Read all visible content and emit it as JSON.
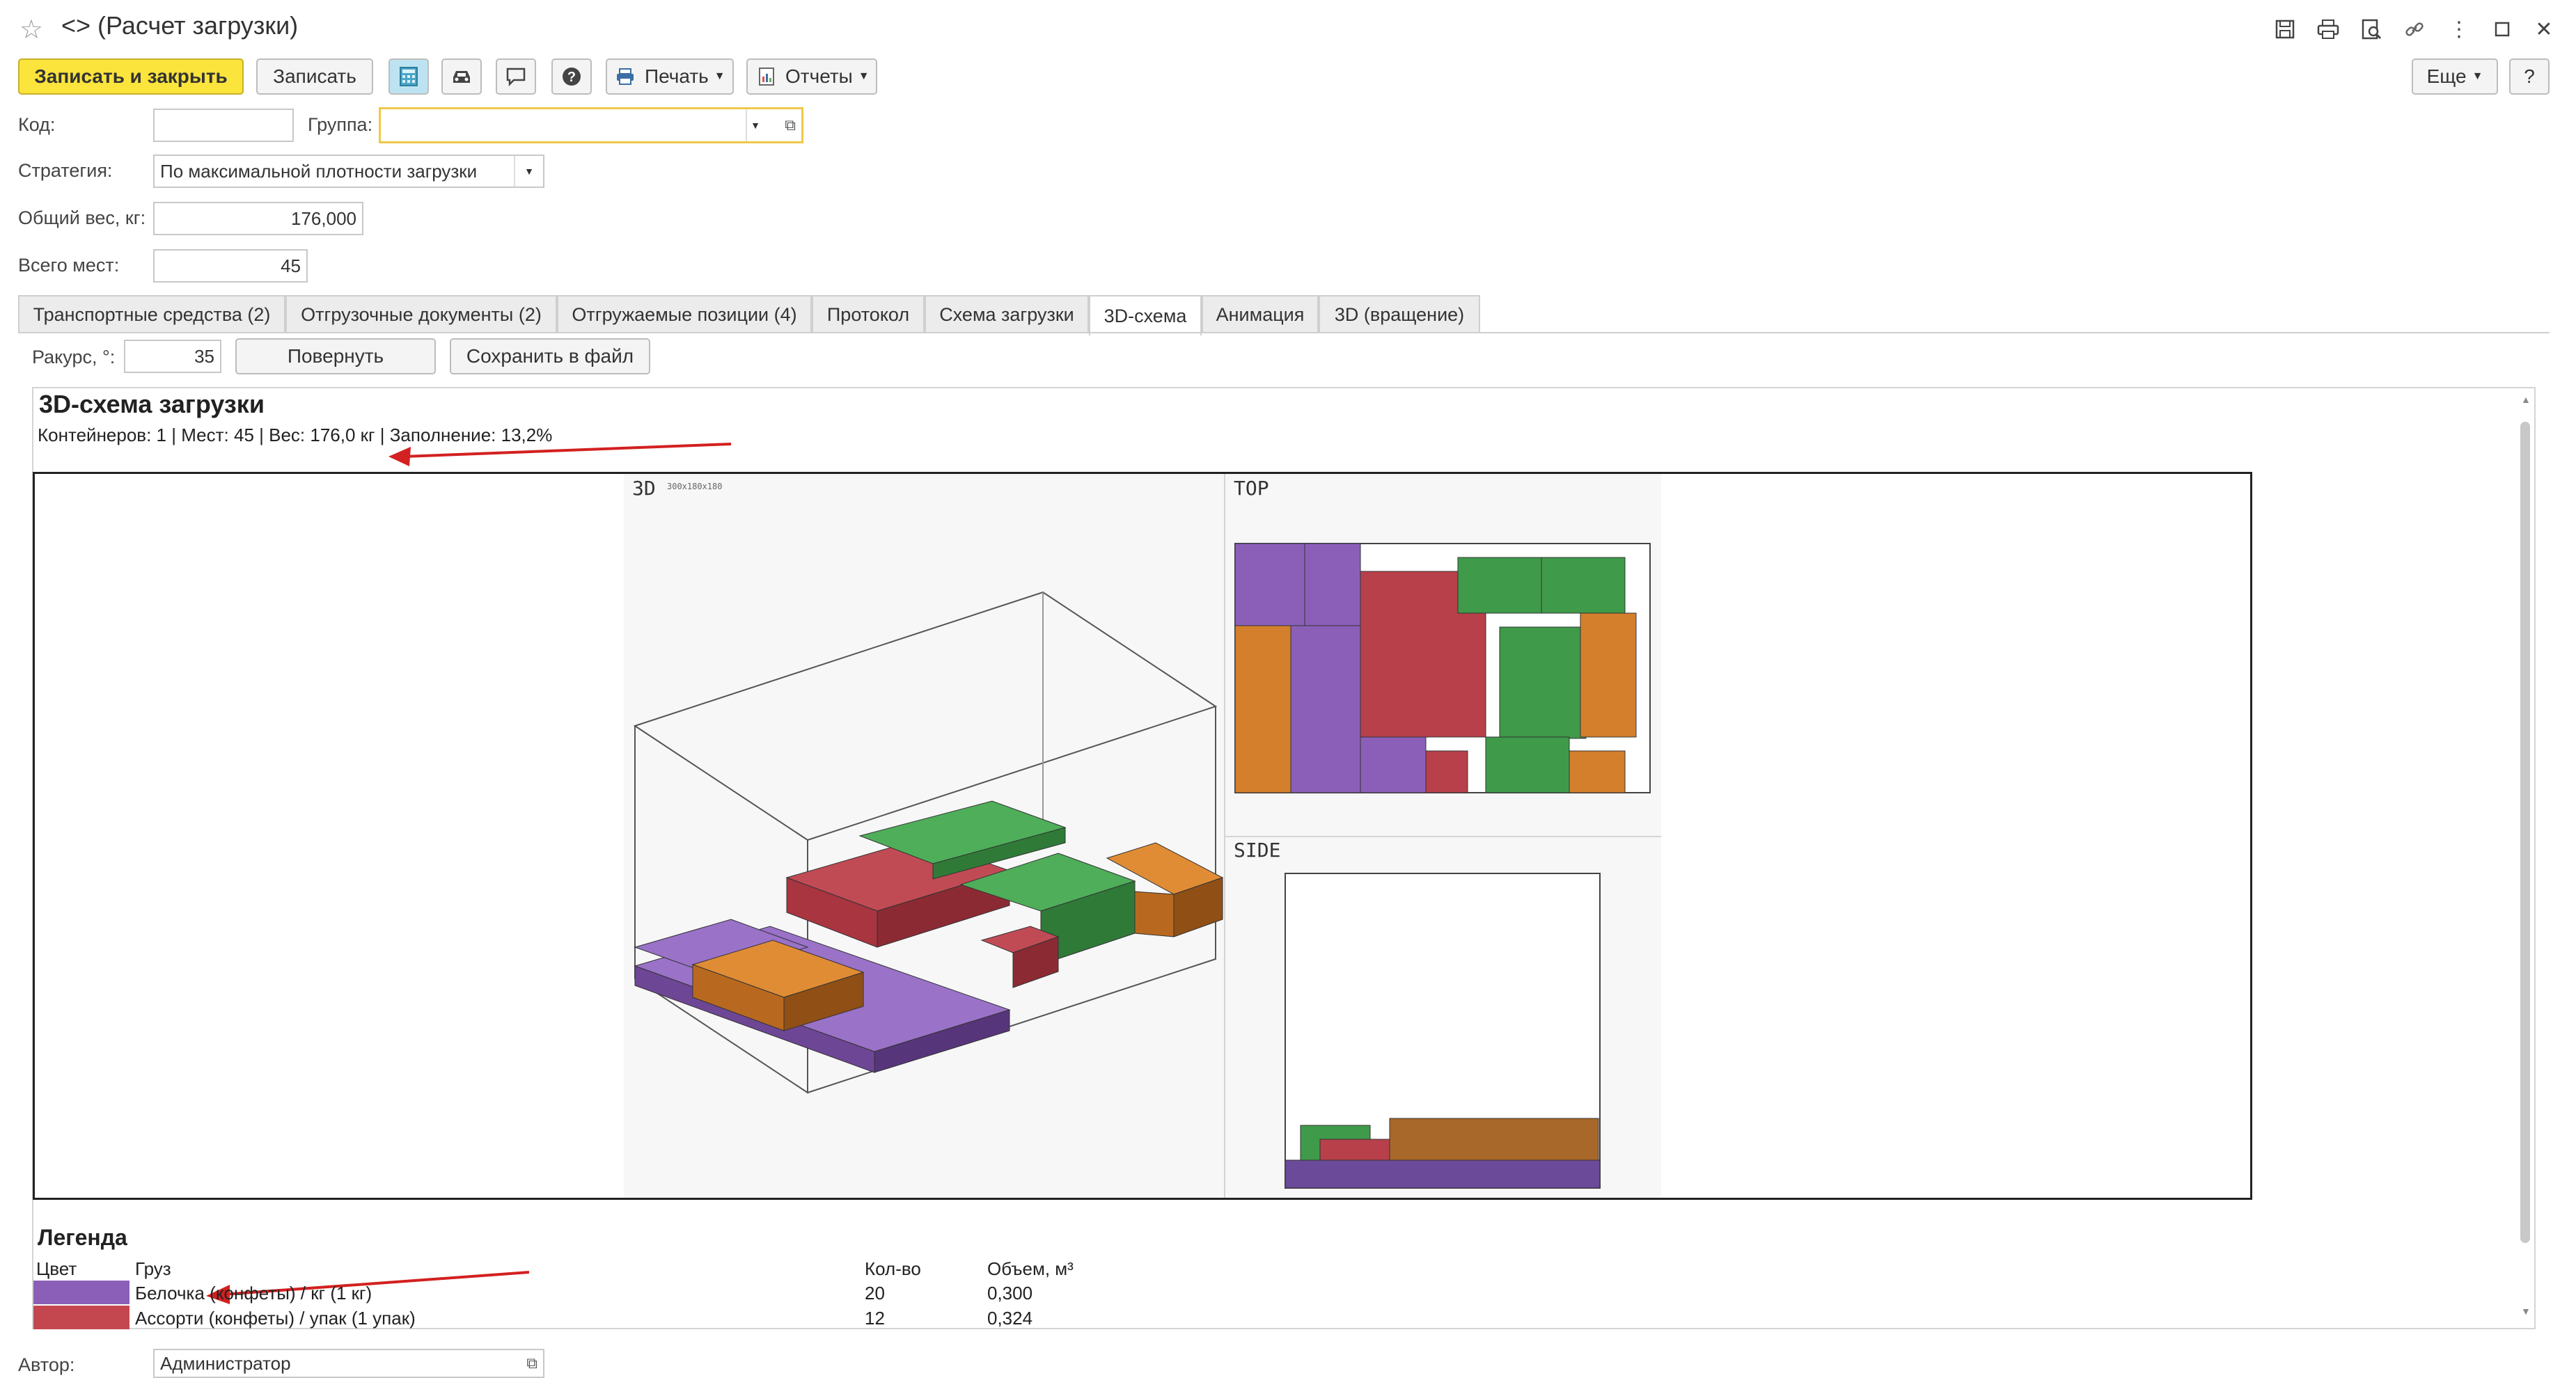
{
  "window": {
    "title": "<> (Расчет загрузки)"
  },
  "toolbar": {
    "save_close": "Записать и закрыть",
    "save": "Записать",
    "print": "Печать",
    "reports": "Отчеты",
    "more": "Еще",
    "help": "?"
  },
  "form": {
    "code_label": "Код:",
    "code_value": "",
    "group_label": "Группа:",
    "group_value": "",
    "strategy_label": "Стратегия:",
    "strategy_value": "По максимальной плотности загрузки",
    "weight_label": "Общий вес, кг:",
    "weight_value": "176,000",
    "places_label": "Всего мест:",
    "places_value": "45",
    "author_label": "Автор:",
    "author_value": "Администратор"
  },
  "tabs": [
    {
      "label": "Транспортные средства (2)"
    },
    {
      "label": "Отгрузочные документы (2)"
    },
    {
      "label": "Отгружаемые позиции (4)"
    },
    {
      "label": "Протокол"
    },
    {
      "label": "Схема загрузки"
    },
    {
      "label": "3D-схема"
    },
    {
      "label": "Анимация"
    },
    {
      "label": "3D (вращение)"
    }
  ],
  "scheme_toolbar": {
    "angle_label": "Ракурс, °:",
    "angle_value": "35",
    "rotate": "Повернуть",
    "save_file": "Сохранить в файл"
  },
  "scheme": {
    "title": "3D-схема загрузки",
    "summary": "Контейнеров: 1 | Мест: 45 | Вес: 176,0 кг | Заполнение: 13,2%",
    "view_3d_label": "3D",
    "view_3d_dims": "300x180x180",
    "view_top_label": "TOP",
    "view_side_label": "SIDE"
  },
  "legend": {
    "title": "Легенда",
    "col_color": "Цвет",
    "col_cargo": "Груз",
    "col_qty": "Кол-во",
    "col_volume": "Объем, м³",
    "rows": [
      {
        "color": "#8b5fb8",
        "cargo": "Белочка (конфеты) / кг (1 кг)",
        "qty": "20",
        "volume": "0,300"
      },
      {
        "color": "#c4474f",
        "cargo": "Ассорти (конфеты) / упак (1 упак)",
        "qty": "12",
        "volume": "0,324"
      }
    ]
  },
  "colors": {
    "purple": "#8b5fb8",
    "red": "#b8404a",
    "green": "#3f9a4a",
    "orange": "#d47f2c",
    "accent_yellow": "#fbe43c",
    "arrow_red": "#d32020"
  }
}
